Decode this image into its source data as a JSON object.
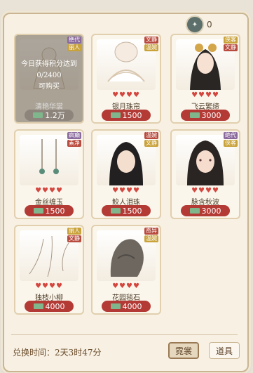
{
  "header": {
    "currency_value": "0",
    "currency_icon": "ticket-coin-icon"
  },
  "cards": [
    {
      "name": "清艳华裳",
      "price": "1.2万",
      "tags": [
        {
          "label": "绝代",
          "color": "#8a6a9d"
        },
        {
          "label": "丽人",
          "color": "#c9a23a"
        }
      ],
      "hearts": "",
      "locked": true,
      "lock_text": [
        "今日获得积分达到",
        "0/2400",
        "可购买"
      ]
    },
    {
      "name": "银月珠帘",
      "price": "1500",
      "tags": [
        {
          "label": "文静",
          "color": "#b84a3e"
        },
        {
          "label": "温婉",
          "color": "#c9a23a"
        }
      ],
      "hearts": "♥♥♥♥",
      "locked": false
    },
    {
      "name": "飞云繁缔",
      "price": "3000",
      "tags": [
        {
          "label": "侠客",
          "color": "#c9a23a"
        },
        {
          "label": "文静",
          "color": "#b84a3e"
        }
      ],
      "hearts": "♥♥♥♥",
      "locked": false
    },
    {
      "name": "金丝缠玉",
      "price": "1500",
      "tags": [
        {
          "label": "疯癫",
          "color": "#8a6a9d"
        },
        {
          "label": "素净",
          "color": "#b84a3e"
        }
      ],
      "hearts": "♥♥♥♥",
      "locked": false
    },
    {
      "name": "鲛人泪珠",
      "price": "1500",
      "tags": [
        {
          "label": "温婉",
          "color": "#b84a3e"
        },
        {
          "label": "文静",
          "color": "#c9a23a"
        }
      ],
      "hearts": "♥♥♥♥",
      "locked": false
    },
    {
      "name": "脉含秋波",
      "price": "3000",
      "tags": [
        {
          "label": "绝代",
          "color": "#8a6a9d"
        },
        {
          "label": "侠客",
          "color": "#c9a23a"
        }
      ],
      "hearts": "♥♥♥♥",
      "locked": false
    },
    {
      "name": "独枝小柳",
      "price": "4000",
      "tags": [
        {
          "label": "丽人",
          "color": "#c9a23a"
        },
        {
          "label": "文静",
          "color": "#b84a3e"
        }
      ],
      "hearts": "♥♥♥♥",
      "locked": false
    },
    {
      "name": "花园毯石",
      "price": "4000",
      "tags": [
        {
          "label": "奇异",
          "color": "#b84a3e"
        },
        {
          "label": "温婉",
          "color": "#c9a23a"
        }
      ],
      "hearts": "♥♥♥♥",
      "locked": false
    }
  ],
  "footer": {
    "time_label": "兑换时间：2天3时47分",
    "primary_button": "霓裳",
    "secondary_button": "道具"
  }
}
